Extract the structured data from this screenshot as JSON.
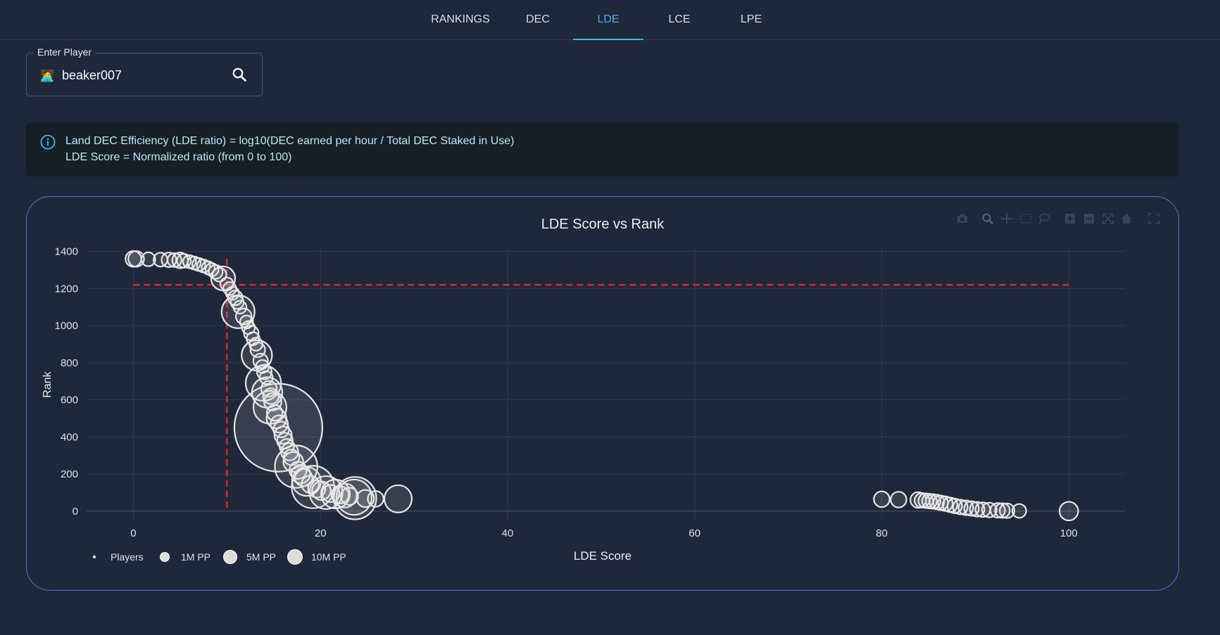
{
  "nav": {
    "tabs": [
      {
        "label": "RANKINGS",
        "active": false
      },
      {
        "label": "DEC",
        "active": false
      },
      {
        "label": "LDE",
        "active": true
      },
      {
        "label": "LCE",
        "active": false
      },
      {
        "label": "LPE",
        "active": false
      }
    ]
  },
  "search": {
    "label": "Enter Player",
    "value": "beaker007",
    "user_icon": "person-emoji-icon",
    "search_icon": "search-icon"
  },
  "info": {
    "icon": "info-icon",
    "line1": "Land DEC Efficiency (LDE ratio) = log10(DEC earned per hour / Total DEC Staked in Use)",
    "line2": "LDE Score = Normalized ratio (from 0 to 100)"
  },
  "colors": {
    "background": "#1f273a",
    "accent": "#3fb7ee",
    "card_border": "#6d5fe0",
    "marker": "#e6e6e6",
    "reference_line": "#e02424"
  },
  "chart_data": {
    "type": "scatter",
    "title": "LDE Score vs Rank",
    "xlabel": "LDE Score",
    "ylabel": "Rank",
    "xlim": [
      -5,
      106
    ],
    "ylim": [
      -50,
      1410
    ],
    "xticks": [
      0,
      20,
      40,
      60,
      80,
      100
    ],
    "yticks": [
      0,
      200,
      400,
      600,
      800,
      1000,
      1200,
      1400
    ],
    "grid": true,
    "legend_position": "bottom-left",
    "legend": [
      {
        "label": "Players",
        "size": "dot"
      },
      {
        "label": "1M PP",
        "size": 1000000
      },
      {
        "label": "5M PP",
        "size": 5000000
      },
      {
        "label": "10M PP",
        "size": 10000000
      }
    ],
    "reference_lines": {
      "x": 10,
      "y": 1220
    },
    "modebar_icons": [
      "camera-icon",
      "zoom-icon",
      "pan-icon",
      "box-select-icon",
      "lasso-icon",
      "zoom-in-icon",
      "zoom-out-icon",
      "autoscale-icon",
      "reset-axes-icon",
      "fullscreen-icon"
    ],
    "series": [
      {
        "points": [
          {
            "x": 0,
            "y": 1360,
            "pp": 150000
          },
          {
            "x": 0.3,
            "y": 1360,
            "pp": 150000
          },
          {
            "x": 1.6,
            "y": 1358,
            "pp": 100000
          },
          {
            "x": 2.9,
            "y": 1356,
            "pp": 100000
          },
          {
            "x": 3.8,
            "y": 1355,
            "pp": 120000
          },
          {
            "x": 4.4,
            "y": 1354,
            "pp": 100000
          },
          {
            "x": 5,
            "y": 1352,
            "pp": 150000
          },
          {
            "x": 5.4,
            "y": 1350,
            "pp": 100000
          },
          {
            "x": 6,
            "y": 1345,
            "pp": 80000
          },
          {
            "x": 6.5,
            "y": 1338,
            "pp": 80000
          },
          {
            "x": 7,
            "y": 1330,
            "pp": 80000
          },
          {
            "x": 7.5,
            "y": 1322,
            "pp": 80000
          },
          {
            "x": 8,
            "y": 1312,
            "pp": 80000
          },
          {
            "x": 8.4,
            "y": 1302,
            "pp": 80000
          },
          {
            "x": 8.8,
            "y": 1290,
            "pp": 100000
          },
          {
            "x": 9.2,
            "y": 1275,
            "pp": 100000
          },
          {
            "x": 9.6,
            "y": 1255,
            "pp": 500000
          },
          {
            "x": 10,
            "y": 1225,
            "pp": 80000
          },
          {
            "x": 10.3,
            "y": 1200,
            "pp": 80000
          },
          {
            "x": 10.6,
            "y": 1175,
            "pp": 80000
          },
          {
            "x": 10.9,
            "y": 1150,
            "pp": 120000
          },
          {
            "x": 11.1,
            "y": 1125,
            "pp": 80000
          },
          {
            "x": 11.4,
            "y": 1100,
            "pp": 80000
          },
          {
            "x": 11.2,
            "y": 1075,
            "pp": 1100000
          },
          {
            "x": 11.8,
            "y": 1050,
            "pp": 150000
          },
          {
            "x": 12.1,
            "y": 1020,
            "pp": 80000
          },
          {
            "x": 12.3,
            "y": 990,
            "pp": 80000
          },
          {
            "x": 12.6,
            "y": 960,
            "pp": 120000
          },
          {
            "x": 12.8,
            "y": 930,
            "pp": 80000
          },
          {
            "x": 13.1,
            "y": 900,
            "pp": 80000
          },
          {
            "x": 13.3,
            "y": 870,
            "pp": 120000
          },
          {
            "x": 13.2,
            "y": 840,
            "pp": 900000
          },
          {
            "x": 13.6,
            "y": 810,
            "pp": 120000
          },
          {
            "x": 13.8,
            "y": 780,
            "pp": 80000
          },
          {
            "x": 14,
            "y": 750,
            "pp": 120000
          },
          {
            "x": 14.2,
            "y": 720,
            "pp": 80000
          },
          {
            "x": 13.9,
            "y": 690,
            "pp": 1300000
          },
          {
            "x": 14.5,
            "y": 660,
            "pp": 150000
          },
          {
            "x": 14.3,
            "y": 640,
            "pp": 900000
          },
          {
            "x": 14.7,
            "y": 620,
            "pp": 150000
          },
          {
            "x": 14.9,
            "y": 590,
            "pp": 200000
          },
          {
            "x": 14.6,
            "y": 560,
            "pp": 1100000
          },
          {
            "x": 15.1,
            "y": 530,
            "pp": 150000
          },
          {
            "x": 15.3,
            "y": 500,
            "pp": 300000
          },
          {
            "x": 15.6,
            "y": 470,
            "pp": 200000
          },
          {
            "x": 15.5,
            "y": 450,
            "pp": 10000000
          },
          {
            "x": 15.8,
            "y": 440,
            "pp": 150000
          },
          {
            "x": 16,
            "y": 410,
            "pp": 200000
          },
          {
            "x": 16.2,
            "y": 380,
            "pp": 150000
          },
          {
            "x": 16.4,
            "y": 350,
            "pp": 120000
          },
          {
            "x": 16.7,
            "y": 320,
            "pp": 200000
          },
          {
            "x": 16.9,
            "y": 290,
            "pp": 150000
          },
          {
            "x": 17.1,
            "y": 265,
            "pp": 300000
          },
          {
            "x": 17.4,
            "y": 240,
            "pp": 2000000
          },
          {
            "x": 17.6,
            "y": 220,
            "pp": 200000
          },
          {
            "x": 17.9,
            "y": 200,
            "pp": 250000
          },
          {
            "x": 18.2,
            "y": 180,
            "pp": 200000
          },
          {
            "x": 18.5,
            "y": 160,
            "pp": 800000
          },
          {
            "x": 18.9,
            "y": 145,
            "pp": 200000
          },
          {
            "x": 19.2,
            "y": 130,
            "pp": 2000000
          },
          {
            "x": 19.6,
            "y": 120,
            "pp": 200000
          },
          {
            "x": 20.1,
            "y": 110,
            "pp": 250000
          },
          {
            "x": 20.6,
            "y": 100,
            "pp": 1100000
          },
          {
            "x": 21.1,
            "y": 95,
            "pp": 200000
          },
          {
            "x": 21.6,
            "y": 92,
            "pp": 800000
          },
          {
            "x": 22.1,
            "y": 88,
            "pp": 200000
          },
          {
            "x": 22.6,
            "y": 84,
            "pp": 500000
          },
          {
            "x": 23.1,
            "y": 80,
            "pp": 200000
          },
          {
            "x": 23.6,
            "y": 75,
            "pp": 1300000
          },
          {
            "x": 23.7,
            "y": 70,
            "pp": 2000000
          },
          {
            "x": 24.8,
            "y": 68,
            "pp": 200000
          },
          {
            "x": 25.9,
            "y": 66,
            "pp": 150000
          },
          {
            "x": 28.3,
            "y": 66,
            "pp": 700000
          },
          {
            "x": 80,
            "y": 64,
            "pp": 150000
          },
          {
            "x": 81.8,
            "y": 62,
            "pp": 150000
          },
          {
            "x": 83.9,
            "y": 60,
            "pp": 150000
          },
          {
            "x": 84.3,
            "y": 58,
            "pp": 120000
          },
          {
            "x": 84.7,
            "y": 56,
            "pp": 120000
          },
          {
            "x": 85.1,
            "y": 54,
            "pp": 120000
          },
          {
            "x": 85.5,
            "y": 52,
            "pp": 120000
          },
          {
            "x": 85.9,
            "y": 49,
            "pp": 120000
          },
          {
            "x": 86.3,
            "y": 45,
            "pp": 120000
          },
          {
            "x": 86.8,
            "y": 40,
            "pp": 120000
          },
          {
            "x": 87.3,
            "y": 34,
            "pp": 120000
          },
          {
            "x": 87.8,
            "y": 28,
            "pp": 120000
          },
          {
            "x": 88.4,
            "y": 22,
            "pp": 120000
          },
          {
            "x": 89,
            "y": 18,
            "pp": 120000
          },
          {
            "x": 89.6,
            "y": 14,
            "pp": 120000
          },
          {
            "x": 90.2,
            "y": 10,
            "pp": 120000
          },
          {
            "x": 90.8,
            "y": 8,
            "pp": 120000
          },
          {
            "x": 91.5,
            "y": 6,
            "pp": 120000
          },
          {
            "x": 92.4,
            "y": 4,
            "pp": 120000
          },
          {
            "x": 92.9,
            "y": 3,
            "pp": 120000
          },
          {
            "x": 93.4,
            "y": 2,
            "pp": 120000
          },
          {
            "x": 94.7,
            "y": 1,
            "pp": 100000
          },
          {
            "x": 100,
            "y": 0,
            "pp": 250000
          }
        ]
      }
    ]
  }
}
